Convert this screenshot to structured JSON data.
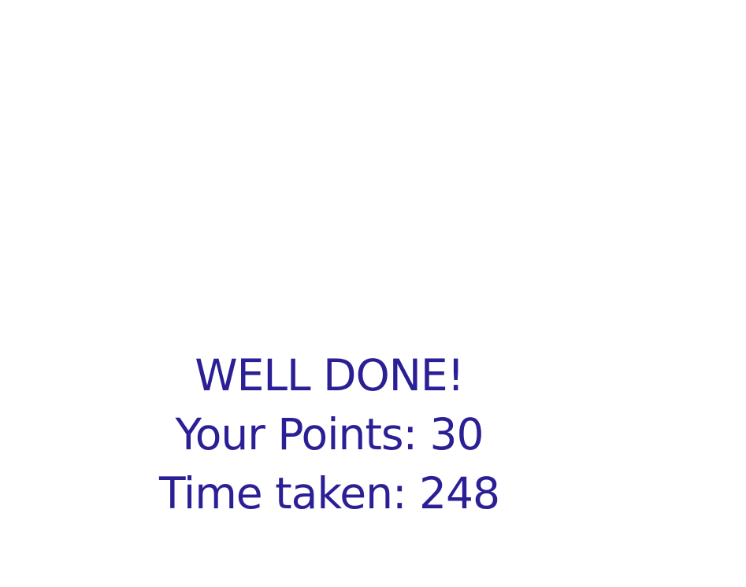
{
  "result": {
    "title": "WELL DONE!",
    "points_line": "Your Points: 30",
    "time_line": "Time taken: 248"
  },
  "colors": {
    "text": "#2b1f96",
    "background": "#ffffff"
  }
}
